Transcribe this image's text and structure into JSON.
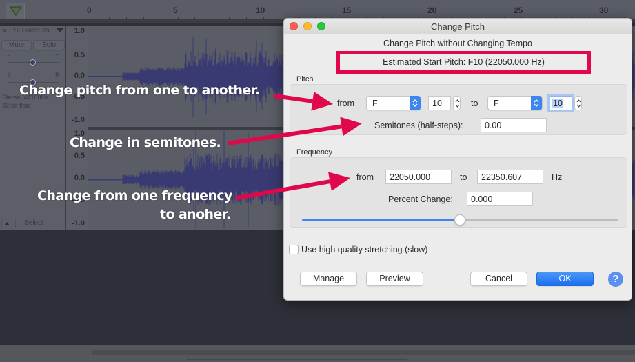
{
  "app": {
    "ruler": {
      "tick_labels": [
        "0",
        "5",
        "10",
        "15",
        "20",
        "25",
        "30"
      ]
    },
    "track": {
      "name": "Si Fuera Yo",
      "mute_label": "Mute",
      "solo_label": "Solo",
      "gain_minus": "-",
      "gain_plus": "+",
      "pan_left": "L",
      "pan_right": "R",
      "info_line1": "Stereo, 44100Hz",
      "info_line2": "32-bit float",
      "select_label": "Select",
      "close_glyph": "×",
      "scale_labels": [
        "1.0",
        "0.5",
        "0.0",
        "-0.5",
        "-1.0"
      ]
    }
  },
  "annotations": {
    "pitch": "Change pitch from one to another.",
    "semitones": "Change in semitones.",
    "frequency_line1": "Change from one frequency",
    "frequency_line2": "to anoher.",
    "arrow_color": "#e0084a"
  },
  "dialog": {
    "title": "Change Pitch",
    "subtitle": "Change Pitch without Changing Tempo",
    "estimated_start_pitch": "Estimated Start Pitch: F10 (22050.000 Hz)",
    "highlight_color": "#e0084a",
    "pitch": {
      "group_label": "Pitch",
      "from_label": "from",
      "from_note": "F",
      "from_octave": "10",
      "to_label": "to",
      "to_note": "F",
      "to_octave": "10",
      "semitones_label": "Semitones (half-steps):",
      "semitones_value": "0.00"
    },
    "frequency": {
      "group_label": "Frequency",
      "from_label": "from",
      "from_value": "22050.000",
      "to_label": "to",
      "to_value": "22350.607",
      "unit_label": "Hz",
      "percent_label": "Percent Change:",
      "percent_value": "0.000",
      "slider_position_fraction": 0.5
    },
    "high_quality_label": "Use high quality stretching (slow)",
    "high_quality_checked": false,
    "buttons": {
      "manage": "Manage",
      "preview": "Preview",
      "cancel": "Cancel",
      "ok": "OK",
      "help": "?"
    },
    "accent_color": "#3d86f0"
  }
}
